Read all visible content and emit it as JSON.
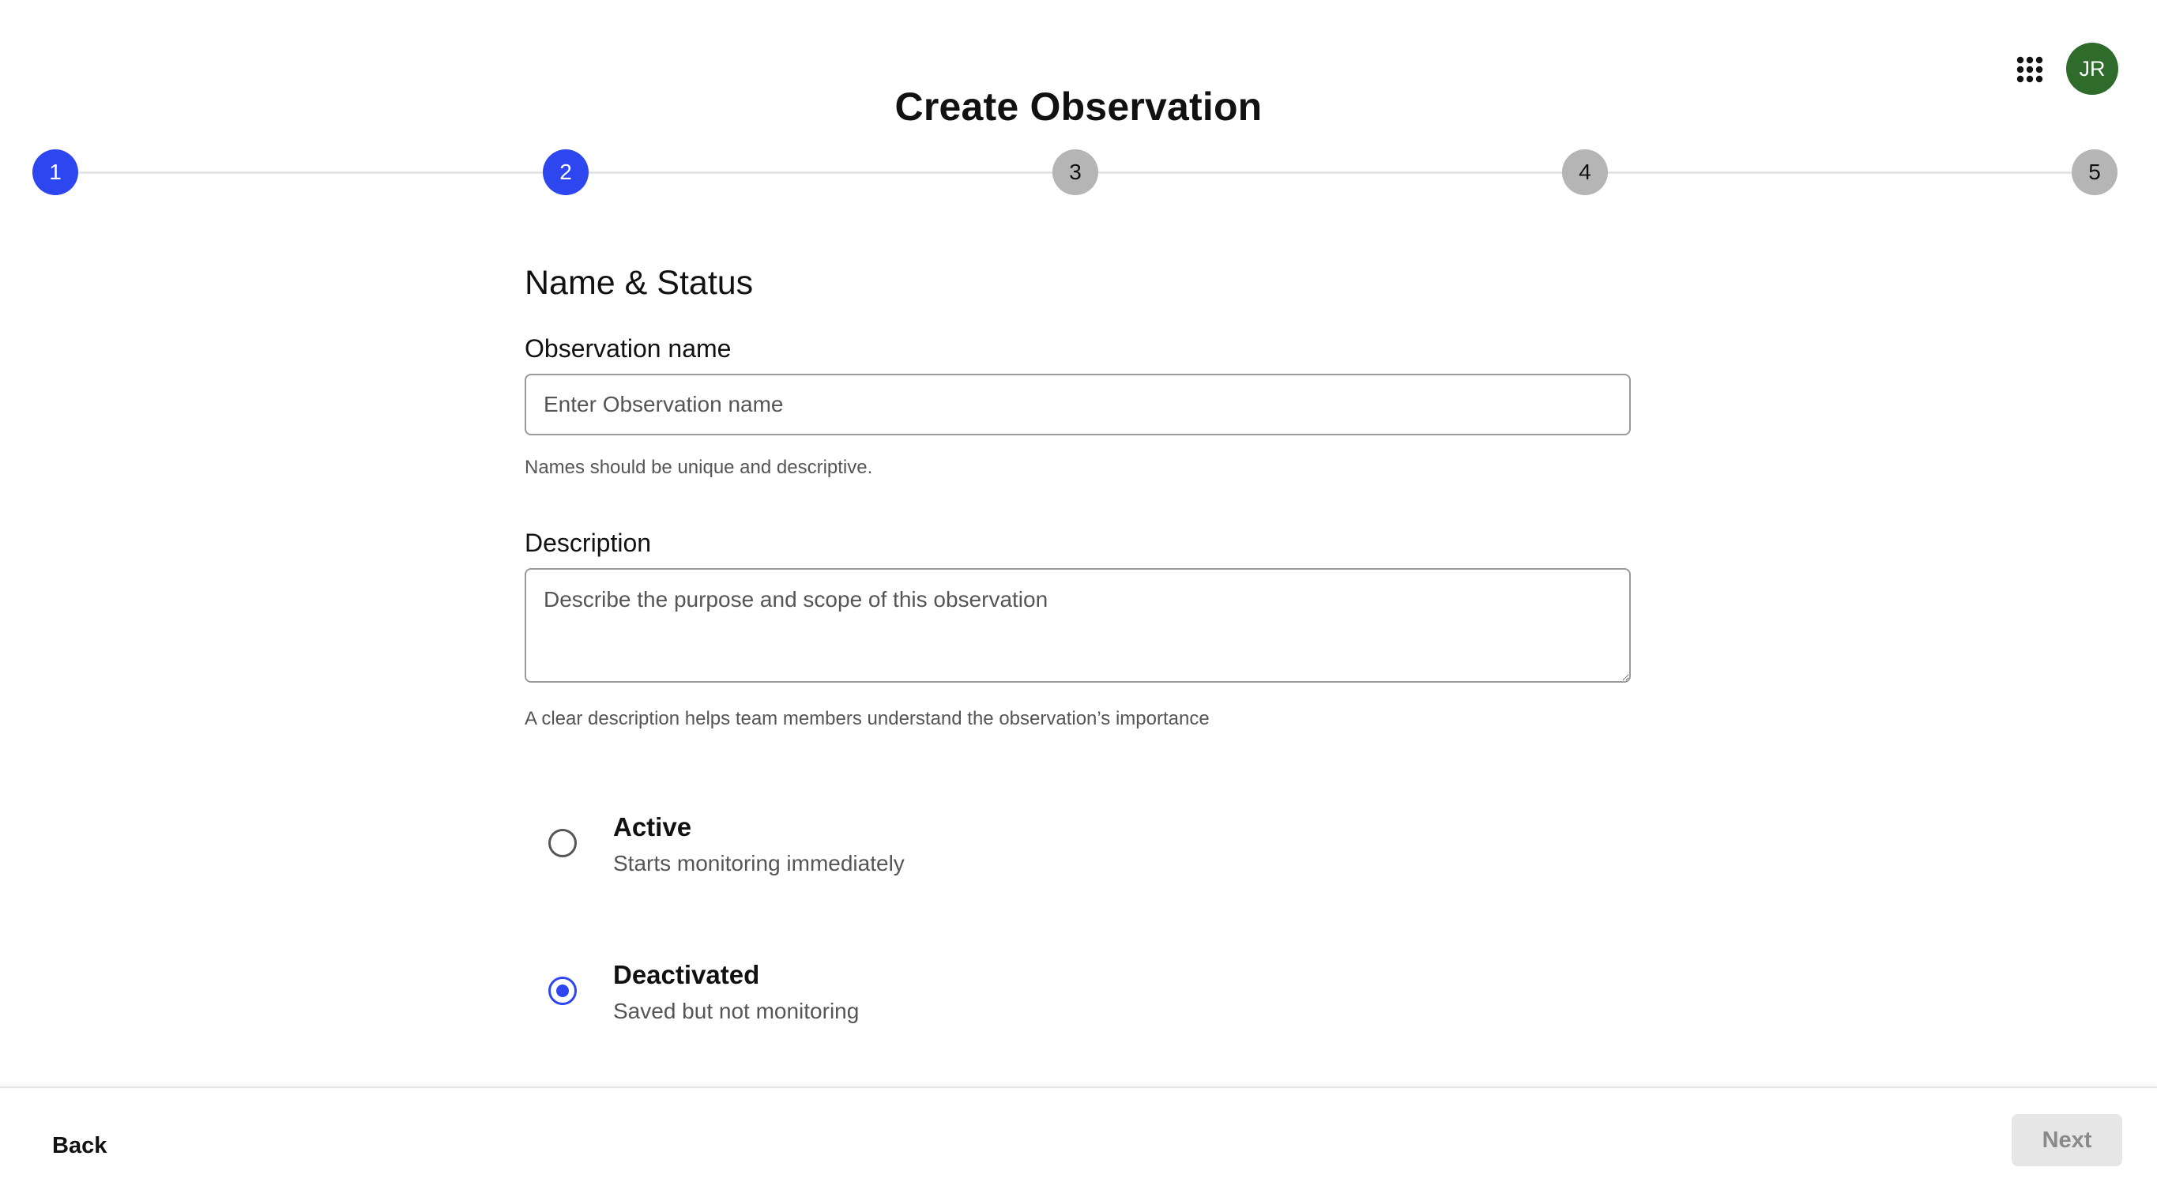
{
  "header": {
    "title": "Create Observation",
    "apps_icon": "grid-icon",
    "avatar_initials": "JR",
    "avatar_color": "#2f6b2b"
  },
  "stepper": {
    "current_step": 2,
    "steps": [
      "1",
      "2",
      "3",
      "4",
      "5"
    ],
    "active_color": "#2e46f0",
    "inactive_color": "#b5b5b5"
  },
  "form": {
    "section_title": "Name & Status",
    "name": {
      "label": "Observation name",
      "value": "",
      "placeholder": "Enter Observation name",
      "help": "Names should be unique and descriptive."
    },
    "description": {
      "label": "Description",
      "value": "",
      "placeholder": "Describe the purpose and scope of this observation",
      "help": "A clear description helps team members understand the observation’s importance"
    },
    "status": {
      "selected": "Deactivated",
      "options": [
        {
          "title": "Active",
          "subtitle": "Starts monitoring immediately"
        },
        {
          "title": "Deactivated",
          "subtitle": "Saved but not monitoring"
        }
      ]
    }
  },
  "footer": {
    "back_label": "Back",
    "next_label": "Next",
    "next_disabled": true
  }
}
